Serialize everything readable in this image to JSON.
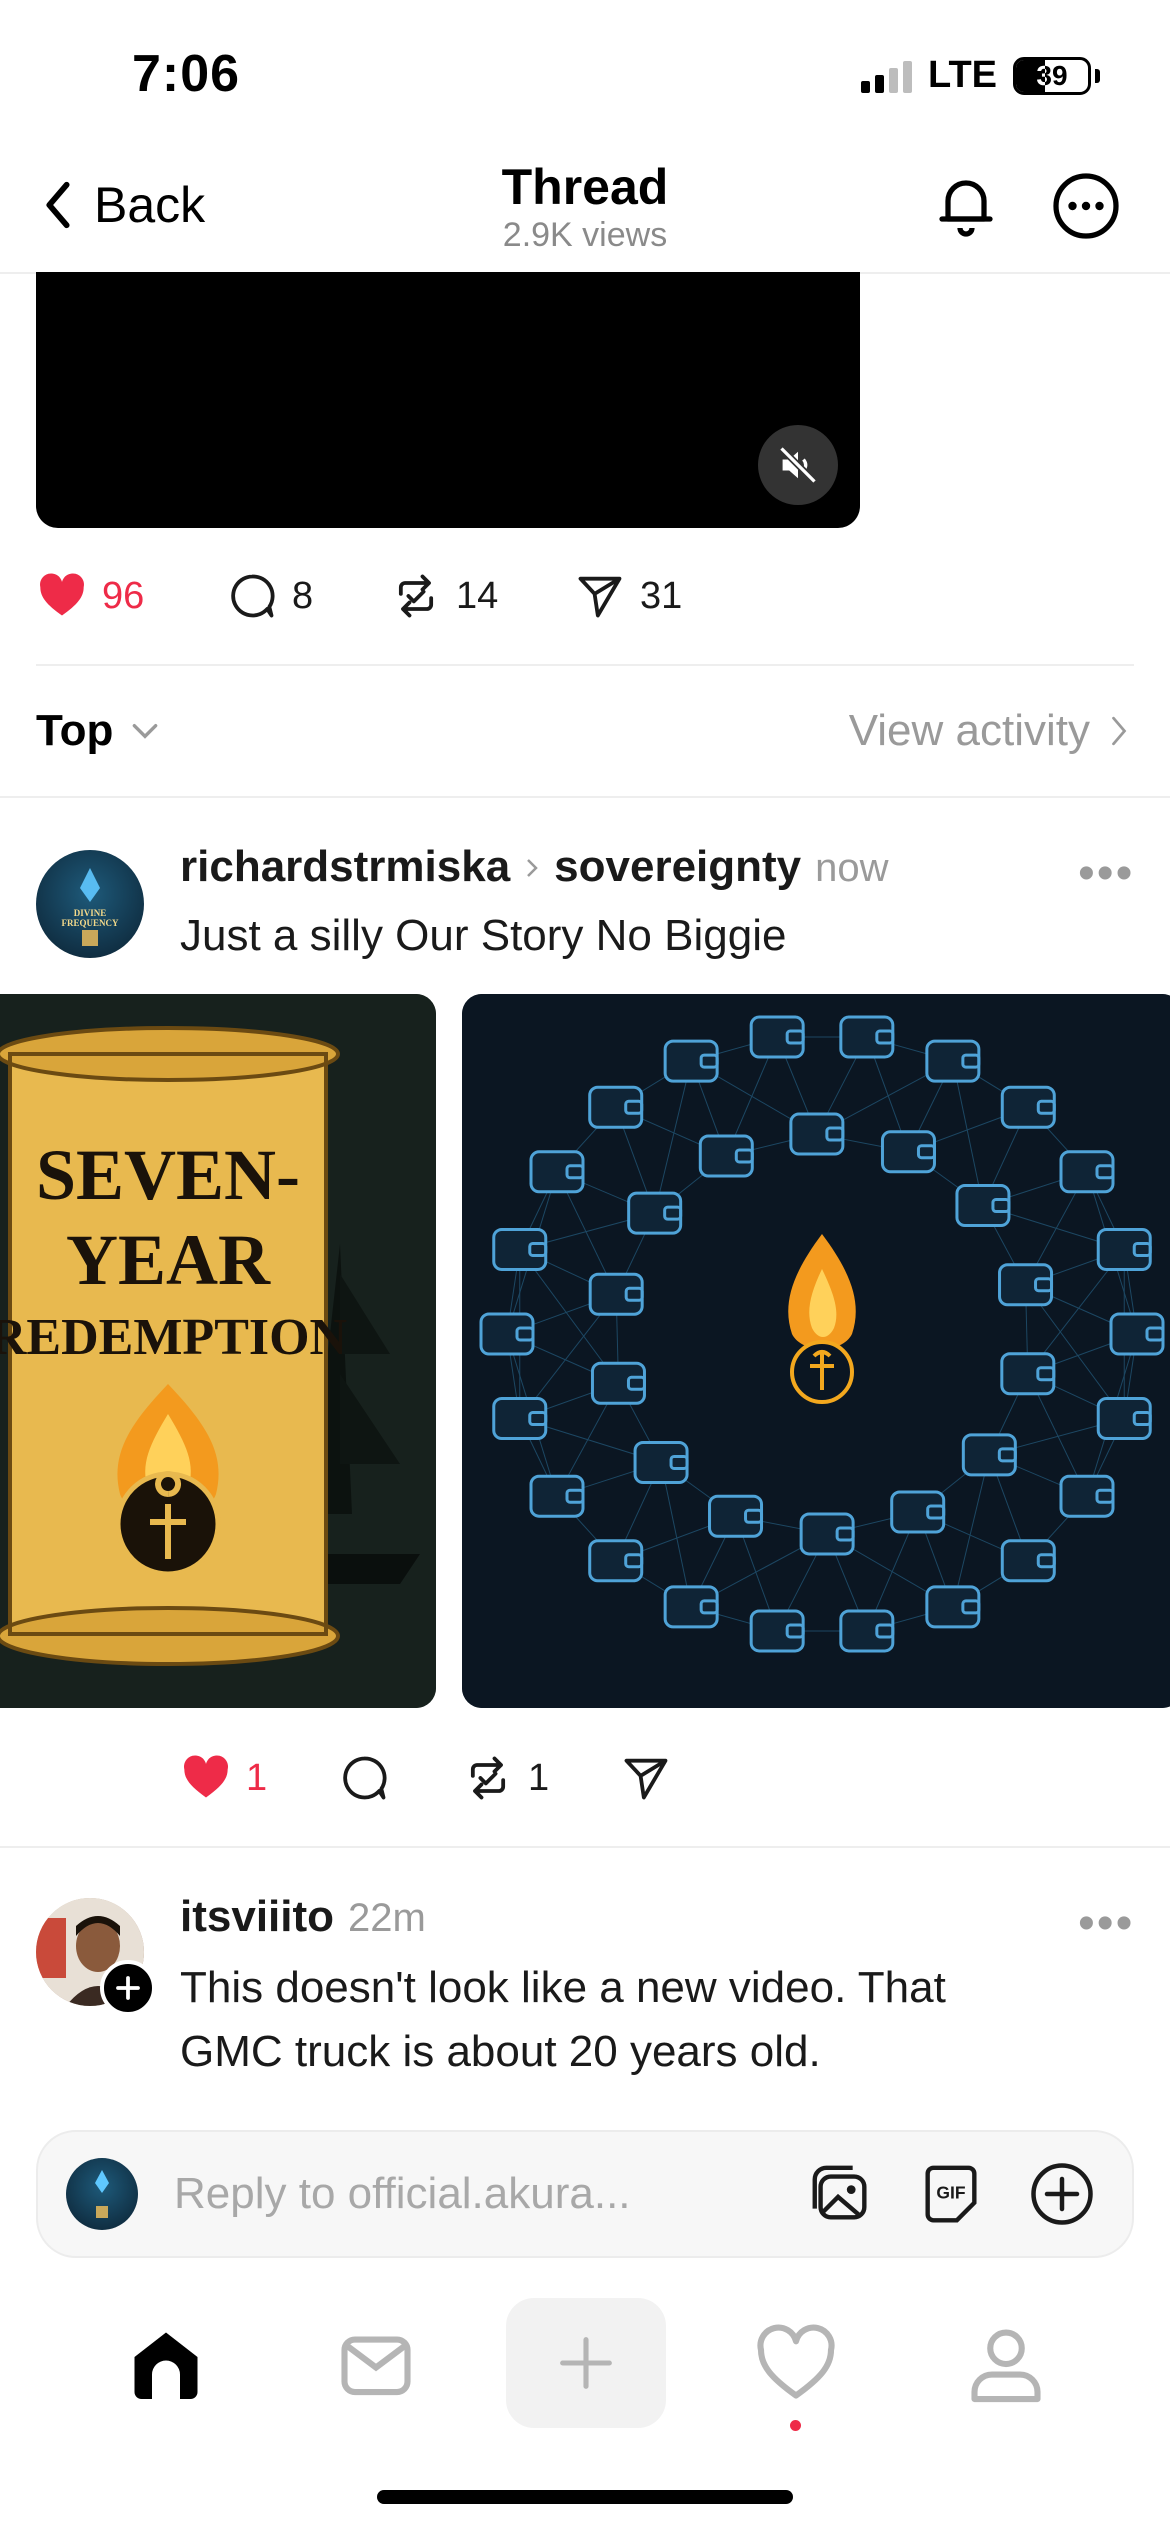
{
  "status_bar": {
    "time": "7:06",
    "network": "LTE",
    "battery": "39"
  },
  "header": {
    "back_label": "Back",
    "title": "Thread",
    "views": "2.9K views"
  },
  "main_post_actions": {
    "likes": "96",
    "comments": "8",
    "reposts": "14",
    "shares": "31"
  },
  "sort": {
    "label": "Top",
    "view_activity": "View activity"
  },
  "reply_post": {
    "username": "richardstrmiska",
    "topic": "sovereignty",
    "time": "now",
    "text": "Just a silly Our Story No Biggie",
    "image1": {
      "lines": [
        "SEVEN-",
        "YEAR",
        "REDEMPTION"
      ]
    },
    "image2_alt_icon": "wallet-network-icon",
    "likes": "1",
    "reposts": "1",
    "avatar_text": [
      "DIVINE",
      "FREQUENCY"
    ]
  },
  "comment_post": {
    "username": "itsviiito",
    "time": "22m",
    "text_line1": "This doesn't look like a new video. That",
    "text_line2": "GMC truck is about 20 years old."
  },
  "reply_bar": {
    "placeholder": "Reply to official.akura..."
  },
  "colors": {
    "like": "#ee2b48",
    "muted": "#9a9a9a",
    "wallet": "#4fa3d8",
    "flame": "#f3a81e"
  }
}
